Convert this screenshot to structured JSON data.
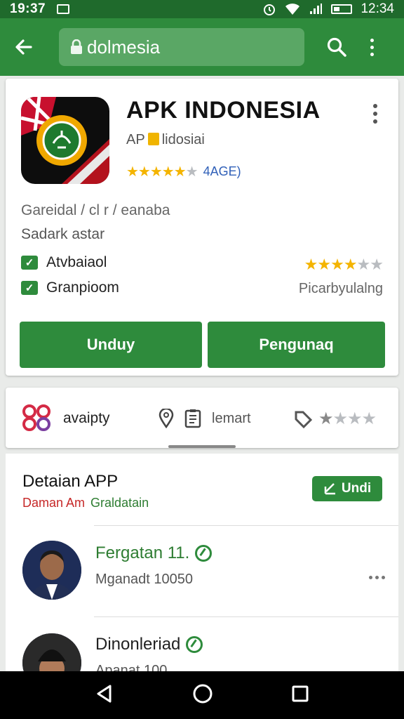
{
  "status": {
    "time_left": "19:37",
    "time_right": "12:34"
  },
  "toolbar": {
    "url": "dolmesia"
  },
  "app": {
    "title": "APK INDONESIA",
    "developer_prefix": "AP",
    "developer_suffix": "lidosiai",
    "rating_count": "4AGE)",
    "meta_line1": "Gareidal / cl r / eanaba",
    "meta_line2": "Sadark astar",
    "features": [
      "Atvbaiaol",
      "Granpioom"
    ],
    "popular_label": "Picarbyulalng",
    "btn_download": "Unduy",
    "btn_secondary": "Pengunaq"
  },
  "tabs": {
    "tab1": "avaipty",
    "tab2": "lemart"
  },
  "details": {
    "title": "Detaian APP",
    "sub_red": "Daman Am",
    "sub_green": "Graldatain",
    "download_btn": "Undi"
  },
  "reviews": [
    {
      "name": "Fergatan 11.",
      "sub": "Mganadt 10050"
    },
    {
      "name": "Dinonleriad",
      "sub": "Apanat 100"
    }
  ],
  "colors": {
    "primary": "#2e8b3c",
    "statusbar": "#1f6a2c",
    "star": "#f4b400",
    "link": "#3060b8"
  }
}
